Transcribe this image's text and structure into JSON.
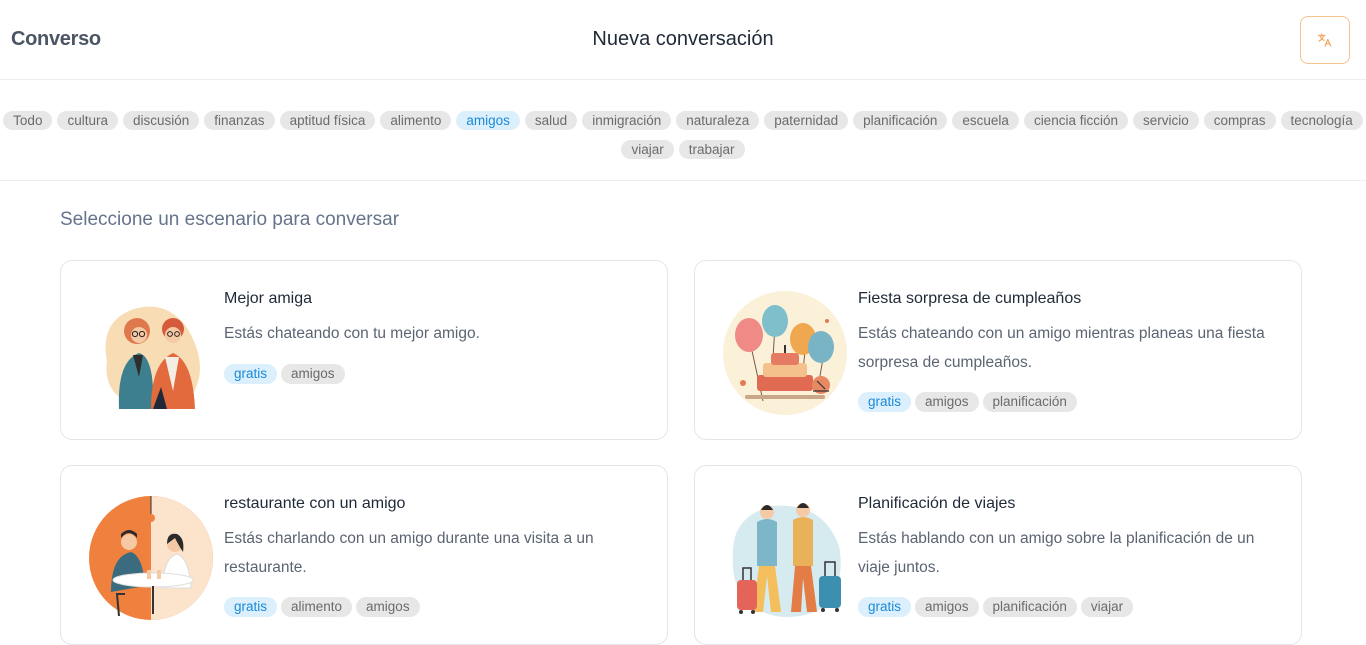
{
  "header": {
    "brand": "Converso",
    "title": "Nueva conversación",
    "translate_icon": "translate-icon"
  },
  "filters": {
    "active": "amigos",
    "tags": [
      "Todo",
      "cultura",
      "discusión",
      "finanzas",
      "aptitud física",
      "alimento",
      "amigos",
      "salud",
      "inmigración",
      "naturaleza",
      "paternidad",
      "planificación",
      "escuela",
      "ciencia ficción",
      "servicio",
      "compras",
      "tecnología",
      "viajar",
      "trabajar"
    ]
  },
  "section": {
    "title": "Seleccione un escenario para conversar"
  },
  "scenarios": [
    {
      "title": "Mejor amiga",
      "description": "Estás chateando con tu mejor amigo.",
      "tags": [
        "gratis",
        "amigos"
      ],
      "illustration": "best-friends-illustration"
    },
    {
      "title": "Fiesta sorpresa de cumpleaños",
      "description": "Estás chateando con un amigo mientras planeas una fiesta sorpresa de cumpleaños.",
      "tags": [
        "gratis",
        "amigos",
        "planificación"
      ],
      "illustration": "birthday-party-illustration"
    },
    {
      "title": "restaurante con un amigo",
      "description": "Estás charlando con un amigo durante una visita a un restaurante.",
      "tags": [
        "gratis",
        "alimento",
        "amigos"
      ],
      "illustration": "restaurant-illustration"
    },
    {
      "title": "Planificación de viajes",
      "description": "Estás hablando con un amigo sobre la planificación de un viaje juntos.",
      "tags": [
        "gratis",
        "amigos",
        "planificación",
        "viajar"
      ],
      "illustration": "travel-illustration"
    }
  ],
  "colors": {
    "accent": "#1a8ad8",
    "chip_bg": "#e7e7e7",
    "free_bg": "#dbeffc",
    "translate_border": "#f5c38f"
  }
}
